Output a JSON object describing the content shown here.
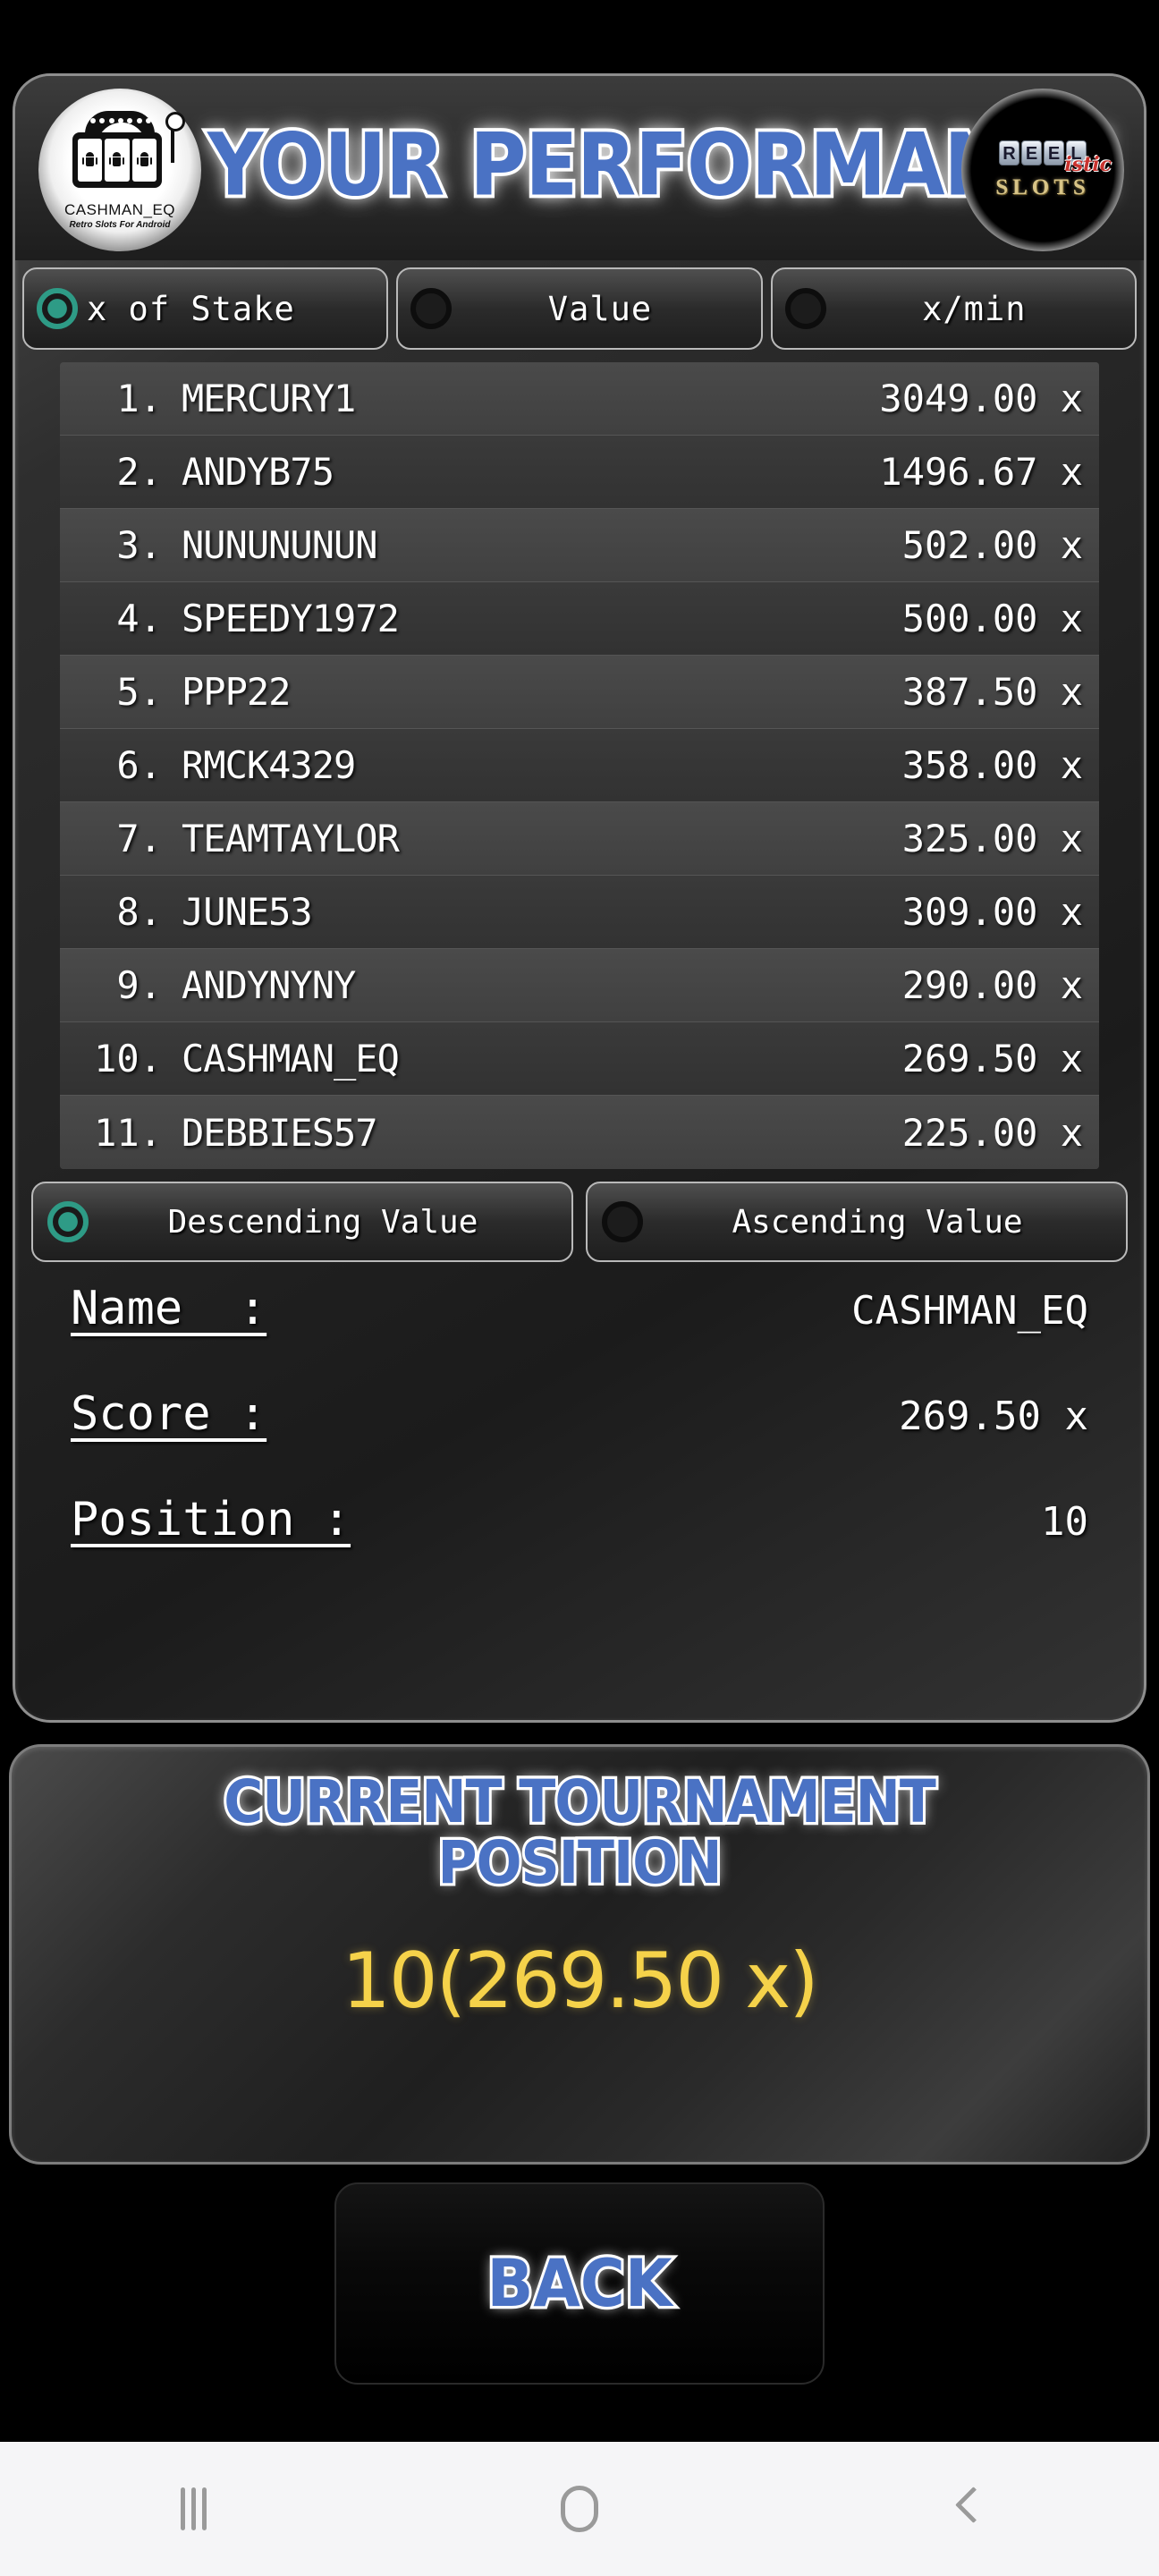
{
  "app": {
    "header": {
      "title": "YOUR PERFORMANCE",
      "logo_left": {
        "name": "CASHMAN_EQ",
        "tagline": "Retro Slots For Android"
      },
      "logo_right": {
        "reel": "REEL",
        "istic": "istic",
        "slots": "SLOTS"
      }
    },
    "metric_tabs": [
      {
        "label": "x of Stake",
        "selected": true
      },
      {
        "label": "Value",
        "selected": false
      },
      {
        "label": "x/min",
        "selected": false
      }
    ],
    "leaderboard": [
      {
        "rank": "1.",
        "name": "MERCURY1",
        "score": "3049.00 x"
      },
      {
        "rank": "2.",
        "name": "ANDYB75",
        "score": "1496.67 x"
      },
      {
        "rank": "3.",
        "name": "NUNUNUNUN",
        "score": "502.00 x"
      },
      {
        "rank": "4.",
        "name": "SPEEDY1972",
        "score": "500.00 x"
      },
      {
        "rank": "5.",
        "name": "PPP22",
        "score": "387.50 x"
      },
      {
        "rank": "6.",
        "name": "RMCK4329",
        "score": "358.00 x"
      },
      {
        "rank": "7.",
        "name": "TEAMTAYLOR",
        "score": "325.00 x"
      },
      {
        "rank": "8.",
        "name": "JUNE53",
        "score": "309.00 x"
      },
      {
        "rank": "9.",
        "name": "ANDYNYNY",
        "score": "290.00 x"
      },
      {
        "rank": "10.",
        "name": "CASHMAN_EQ",
        "score": "269.50 x"
      },
      {
        "rank": "11.",
        "name": "DEBBIES57",
        "score": "225.00 x"
      }
    ],
    "sort_options": [
      {
        "label": "Descending Value",
        "selected": true
      },
      {
        "label": "Ascending Value",
        "selected": false
      }
    ],
    "detail": {
      "name_label": "Name  :",
      "name_value": "CASHMAN_EQ",
      "score_label": "Score :",
      "score_value": "269.50 x",
      "position_label": "Position :",
      "position_value": "10"
    },
    "tournament": {
      "title_line1": "CURRENT TOURNAMENT",
      "title_line2": "POSITION",
      "value": "10(269.50 x)"
    },
    "back_button": "BACK",
    "colors": {
      "accent_blue": "#4a72c4",
      "radio_on": "#2e9b86",
      "gold": "#f5d24a",
      "panel_border": "#8e8e8e"
    }
  },
  "navbar": {
    "recents": "recents",
    "home": "home",
    "back": "back"
  }
}
